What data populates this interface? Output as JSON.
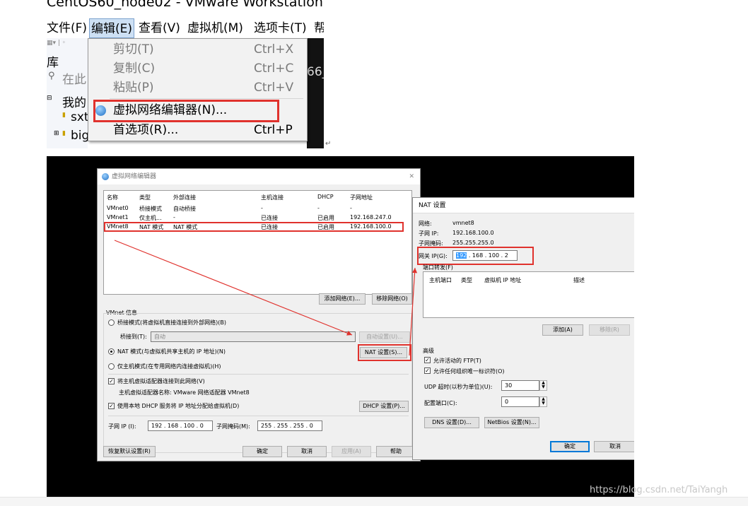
{
  "top": {
    "window_title": "CentOS60_node02 - VMware Workstation",
    "menu": [
      {
        "label": "文件(F)"
      },
      {
        "label": "编辑(E)"
      },
      {
        "label": "查看(V)"
      },
      {
        "label": "虚拟机(M)"
      },
      {
        "label": "选项卡(T)"
      },
      {
        "label": "帮"
      }
    ],
    "sidebar_title": "库",
    "search_placeholder": "在此",
    "tree": [
      "我的",
      "sxt",
      "big"
    ],
    "right_fragment": "66_",
    "edit_menu": [
      {
        "label": "剪切(T)",
        "shortcut": "Ctrl+X"
      },
      {
        "label": "复制(C)",
        "shortcut": "Ctrl+C"
      },
      {
        "label": "粘贴(P)",
        "shortcut": "Ctrl+V"
      },
      {
        "label": "虚拟网络编辑器(N)...",
        "shortcut": ""
      },
      {
        "label": "首选项(R)...",
        "shortcut": "Ctrl+P"
      }
    ]
  },
  "vne": {
    "title": "虚拟网络编辑器",
    "columns": [
      "名称",
      "类型",
      "外部连接",
      "主机连接",
      "DHCP",
      "子网地址"
    ],
    "rows": [
      [
        "VMnet0",
        "桥接模式",
        "自动桥接",
        "-",
        "-",
        "-"
      ],
      [
        "VMnet1",
        "仅主机...",
        "-",
        "已连接",
        "已启用",
        "192.168.247.0"
      ],
      [
        "VMnet8",
        "NAT 模式",
        "NAT 模式",
        "已连接",
        "已启用",
        "192.168.100.0"
      ]
    ],
    "add_network": "添加网络(E)...",
    "remove_network": "移除网络(O)",
    "info_title": "VMnet 信息",
    "radio_bridge": "桥接模式(将虚拟机直接连接到外部网络)(B)",
    "bridge_to_label": "桥接到(T):",
    "bridge_to_value": "自动",
    "auto_settings": "自动设置(U)...",
    "radio_nat": "NAT 模式(与虚拟机共享主机的 IP 地址)(N)",
    "nat_settings": "NAT 设置(S)...",
    "radio_hostonly": "仅主机模式(在专用网络内连接虚拟机)(H)",
    "check_adapter": "将主机虚拟适配器连接到此网络(V)",
    "adapter_name": "主机虚拟适配器名称: VMware 网络适配器 VMnet8",
    "check_dhcp": "使用本地 DHCP 服务将 IP 地址分配给虚拟机(D)",
    "dhcp_settings": "DHCP 设置(P)...",
    "subnet_ip_label": "子网 IP (I):",
    "subnet_ip": "192 . 168 . 100 .  0",
    "subnet_mask_label": "子网掩码(M):",
    "subnet_mask": "255 . 255 . 255 .  0",
    "restore": "恢复默认设置(R)",
    "ok": "确定",
    "cancel": "取消",
    "apply": "应用(A)",
    "help": "帮助"
  },
  "nat": {
    "title": "NAT 设置",
    "network_label": "网络:",
    "network_value": "vmnet8",
    "subnet_ip_label": "子网 IP:",
    "subnet_ip": "192.168.100.0",
    "subnet_mask_label": "子网掩码:",
    "subnet_mask": "255.255.255.0",
    "gateway_label": "网关 IP(G):",
    "gateway_sel": "192",
    "gateway_rest": " . 168 . 100 .  2",
    "port_forward_label": "端口转发(F)",
    "pf_columns": [
      "主机端口",
      "类型",
      "虚拟机 IP 地址",
      "描述"
    ],
    "add": "添加(A)",
    "remove": "移除(R)",
    "advanced": "高级",
    "allow_ftp": "允许活动的 FTP(T)",
    "allow_oui": "允许任何组织唯一标识符(O)",
    "udp_label": "UDP 超时(以秒为单位)(U):",
    "udp_value": "30",
    "config_port_label": "配置端口(C):",
    "config_port_value": "0",
    "dns": "DNS 设置(D)...",
    "netbios": "NetBios 设置(N)...",
    "ok": "确定",
    "cancel": "取消"
  },
  "watermark": "https://blog.csdn.net/TaiYangh",
  "colors": {
    "highlight_red": "#e0322d",
    "accent_blue": "#0078d7"
  }
}
